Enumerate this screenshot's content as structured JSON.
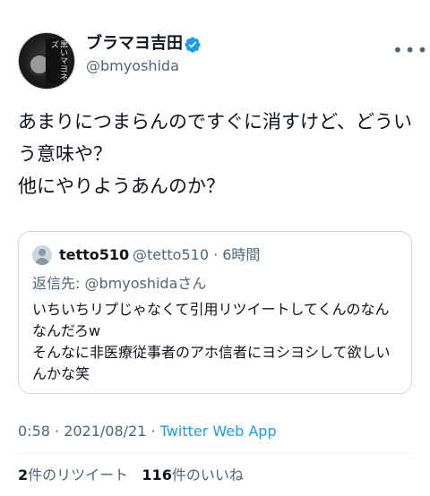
{
  "author": {
    "display_name": "ブラマヨ吉田",
    "handle": "@bmyoshida",
    "avatar_text": "黒いマヨネーズ",
    "verified": true
  },
  "tweet": {
    "text": "あまりにつまらんのですぐに消すけど、どういう意味や？\n他にやりようあんのか？"
  },
  "quote": {
    "display_name": "tetto510",
    "handle_time": "@tetto510 · 6時間",
    "reply_label": "返信先: ",
    "reply_mention": "@bmyoshida",
    "reply_suffix": "さん",
    "text": "いちいちリプじゃなくて引用リツイートしてくんのなんなんだろw\nそんなに非医療従事者のアホ信者にヨシヨシして欲しいんかな笑"
  },
  "meta": {
    "timestamp": "0:58 · 2021/08/21 · ",
    "app": "Twitter Web App"
  },
  "stats": {
    "retweet_count": "2",
    "retweet_label": "件のリツイート",
    "like_count": "116",
    "like_label": "件のいいね"
  },
  "colors": {
    "link": "#1d9bf0",
    "secondary_text": "#536471",
    "verified": "#1d9bf0"
  }
}
